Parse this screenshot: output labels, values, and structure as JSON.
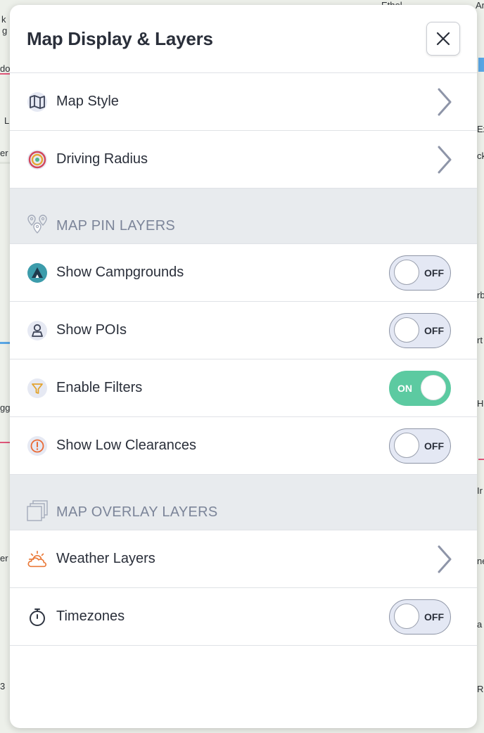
{
  "panel": {
    "title": "Map Display & Layers",
    "close_label": "×"
  },
  "rows_top": [
    {
      "label": "Map Style",
      "icon": "map-icon"
    },
    {
      "label": "Driving Radius",
      "icon": "target-icon"
    }
  ],
  "section_pins": {
    "label": "MAP PIN LAYERS",
    "icon": "map-pins-icon"
  },
  "pin_rows": [
    {
      "label": "Show Campgrounds",
      "icon": "campground-icon",
      "toggle": "OFF"
    },
    {
      "label": "Show POIs",
      "icon": "poi-person-icon",
      "toggle": "OFF"
    },
    {
      "label": "Enable Filters",
      "icon": "filter-icon",
      "toggle": "ON"
    },
    {
      "label": "Show Low Clearances",
      "icon": "warning-icon",
      "toggle": "OFF"
    }
  ],
  "section_overlay": {
    "label": "MAP OVERLAY LAYERS",
    "icon": "layers-icon"
  },
  "overlay_rows": [
    {
      "label": "Weather Layers",
      "icon": "weather-icon"
    },
    {
      "label": "Timezones",
      "icon": "stopwatch-icon",
      "toggle": "OFF"
    }
  ],
  "map_labels": [
    "k",
    "g",
    "do",
    "L",
    "er",
    "gg",
    "er",
    "Ethel",
    "Ar",
    "Ex",
    "ck",
    "rb",
    "rt",
    "Ha",
    "Ir",
    "ne",
    "a",
    "R",
    "3"
  ],
  "colors": {
    "toggle_on": "#5ccaa1",
    "toggle_off": "#e4e8f4",
    "section_bg": "#e8ebee",
    "text": "#2a2f3a",
    "muted": "#7c8599"
  }
}
